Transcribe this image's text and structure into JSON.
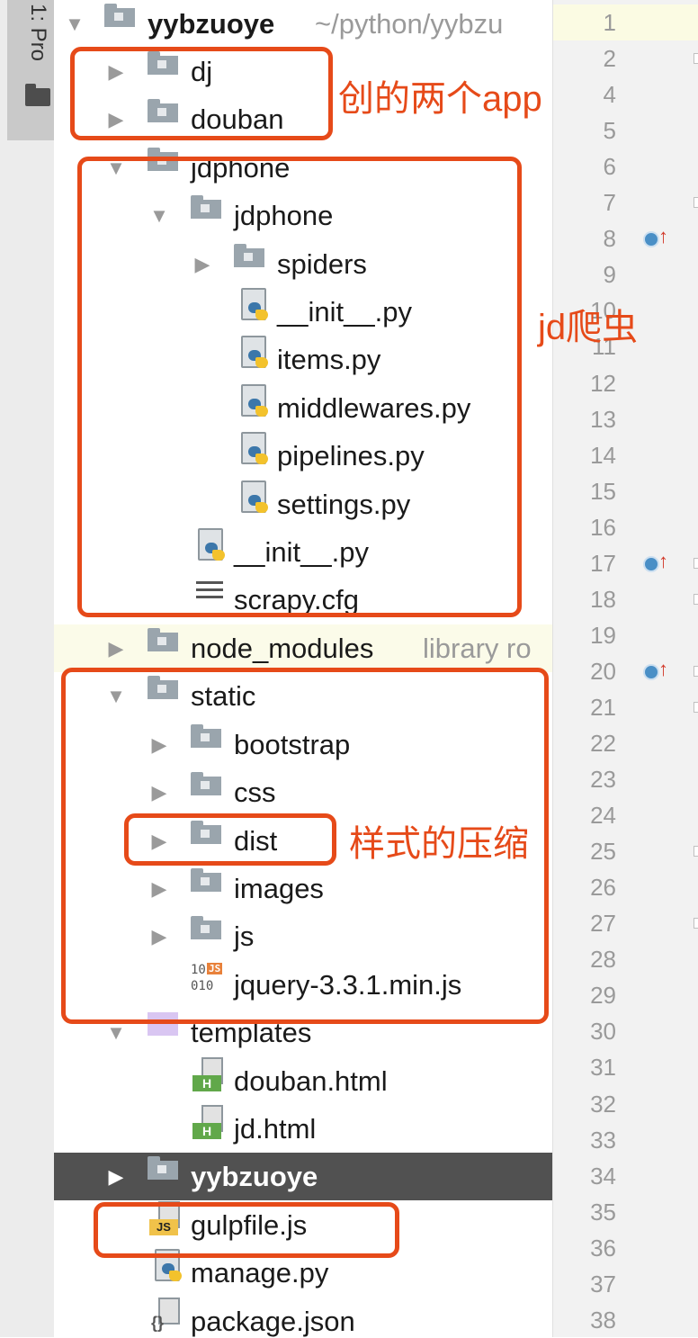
{
  "toolwindow": {
    "tab_label": "1: Pro"
  },
  "tree": {
    "root": {
      "name": "yybzuoye",
      "path": "~/python/yybzu"
    },
    "dj": "dj",
    "douban": "douban",
    "jdphone": "jdphone",
    "jdphone_inner": "jdphone",
    "spiders": "spiders",
    "init_py_1": "__init__.py",
    "items_py": "items.py",
    "middlewares_py": "middlewares.py",
    "pipelines_py": "pipelines.py",
    "settings_py": "settings.py",
    "init_py_2": "__init__.py",
    "scrapy_cfg": "scrapy.cfg",
    "node_modules": {
      "name": "node_modules",
      "hint": "library ro"
    },
    "static": "static",
    "bootstrap": "bootstrap",
    "css": "css",
    "dist": "dist",
    "images": "images",
    "js": "js",
    "jquery": "jquery-3.3.1.min.js",
    "templates": "templates",
    "douban_html": "douban.html",
    "jd_html": "jd.html",
    "yybzuoye_pkg": "yybzuoye",
    "gulpfile": "gulpfile.js",
    "manage_py": "manage.py",
    "package_json": "package.json"
  },
  "icons": {
    "bin_top": "10",
    "bin_bottom": "010",
    "bin_tag": "JS",
    "html_tag": "H",
    "js_tag": "JS",
    "json_tag": "{}"
  },
  "gutter": {
    "line_numbers": [
      "1",
      "2",
      "4",
      "5",
      "6",
      "7",
      "8",
      "9",
      "10",
      "11",
      "12",
      "13",
      "14",
      "15",
      "16",
      "17",
      "18",
      "19",
      "20",
      "21",
      "22",
      "23",
      "24",
      "25",
      "26",
      "27",
      "28",
      "29",
      "30",
      "31",
      "32",
      "33",
      "34",
      "35",
      "36",
      "37",
      "38"
    ],
    "markers": [
      "8",
      "17",
      "20"
    ]
  },
  "annotations": {
    "apps": "创的两个app",
    "spider": "jd爬虫",
    "style": "样式的压缩"
  },
  "colors": {
    "annotation": "#e64a19",
    "selected_row": "#515151",
    "highlight_row": "#fbfbe9"
  }
}
